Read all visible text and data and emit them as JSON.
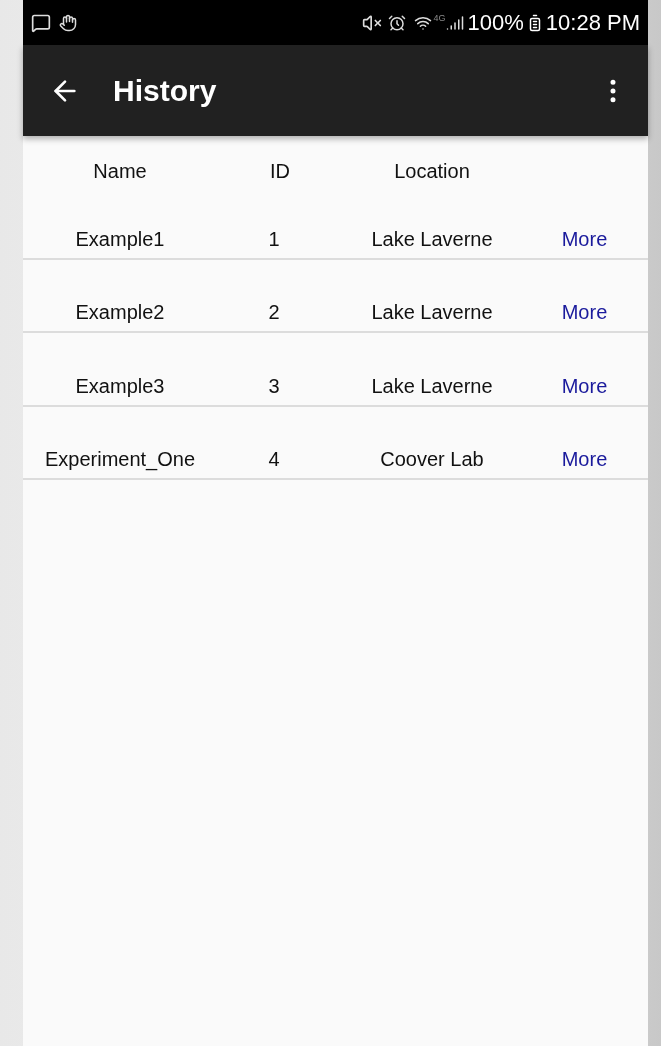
{
  "status_bar": {
    "network": "4G",
    "battery": "100%",
    "time": "10:28 PM"
  },
  "app_bar": {
    "title": "History"
  },
  "table": {
    "columns": [
      "Name",
      "ID",
      "Location"
    ],
    "rows": [
      {
        "name": "Example1",
        "id": "1",
        "location": "Lake Laverne",
        "action": "More"
      },
      {
        "name": "Example2",
        "id": "2",
        "location": "Lake Laverne",
        "action": "More"
      },
      {
        "name": "Example3",
        "id": "3",
        "location": "Lake Laverne",
        "action": "More"
      },
      {
        "name": "Experiment_One",
        "id": "4",
        "location": "Coover Lab",
        "action": "More"
      }
    ]
  }
}
